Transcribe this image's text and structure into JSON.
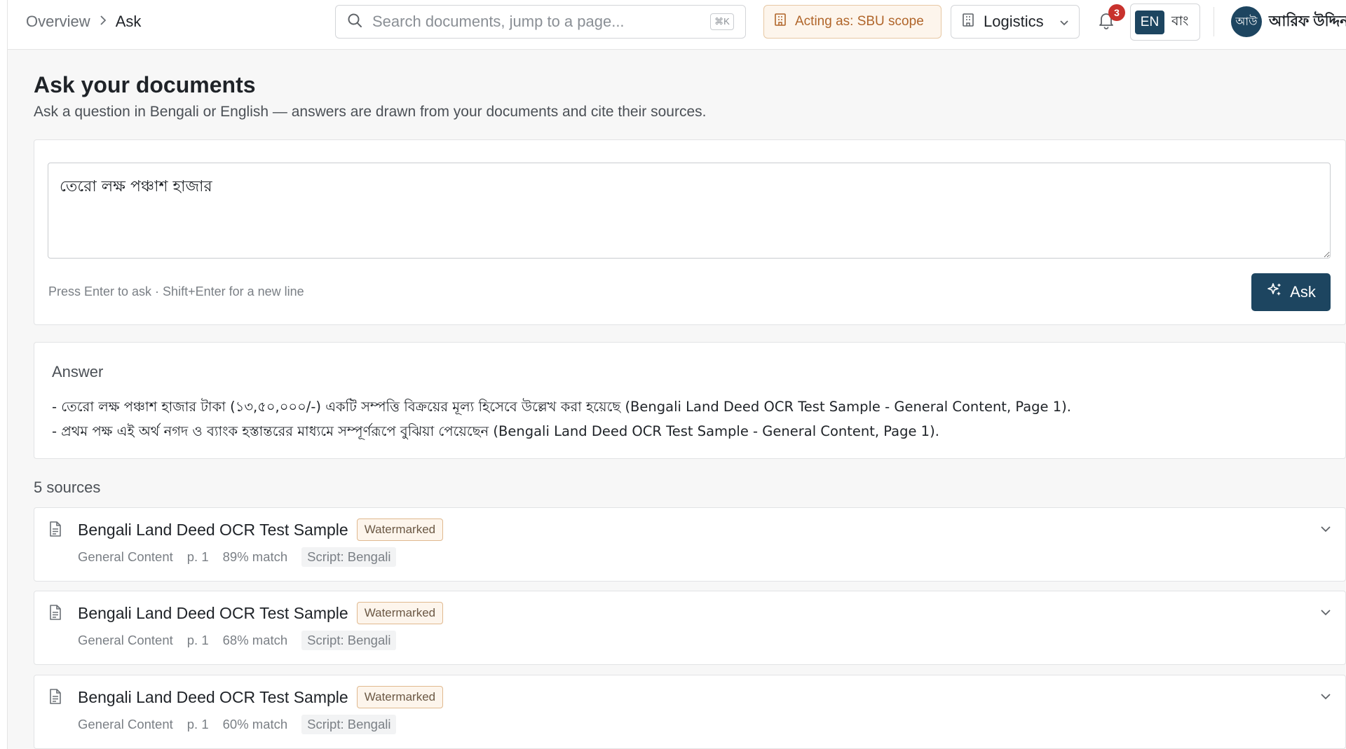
{
  "breadcrumb": {
    "root": "Overview",
    "current": "Ask"
  },
  "search": {
    "placeholder": "Search documents, jump to a page...",
    "shortcut": "⌘K"
  },
  "scope": {
    "label": "Acting as: SBU scope"
  },
  "org": {
    "label": "Logistics"
  },
  "notifications": {
    "count": "3"
  },
  "language": {
    "en": "EN",
    "bn": "বাং"
  },
  "user": {
    "initials": "আউ",
    "name": "আরিফ উদ্দিন"
  },
  "page": {
    "title": "Ask your documents",
    "subtitle": "Ask a question in Bengali or English — answers are drawn from your documents and cite their sources."
  },
  "ask": {
    "question": "তেরো লক্ষ পঞ্চাশ হাজার",
    "hint": "Press Enter to ask · Shift+Enter for a new line",
    "button_label": "Ask"
  },
  "answer": {
    "label": "Answer",
    "lines": [
      "- তেরো লক্ষ পঞ্চাশ হাজার টাকা (১৩,৫০,০০০/-) একটি সম্পত্তি বিক্রয়ের মূল্য হিসেবে উল্লেখ করা হয়েছে (Bengali Land Deed OCR Test Sample - General Content, Page 1).",
      "- প্রথম পক্ষ এই অর্থ নগদ ও ব্যাংক হস্তান্তরের মাধ্যমে সম্পূর্ণরূপে বুঝিয়া পেয়েছেন (Bengali Land Deed OCR Test Sample - General Content, Page 1)."
    ]
  },
  "sources": {
    "count_label": "5 sources",
    "items": [
      {
        "title": "Bengali Land Deed OCR Test Sample",
        "badge": "Watermarked",
        "category": "General Content",
        "page": "p. 1",
        "match": "89% match",
        "script": "Script: Bengali"
      },
      {
        "title": "Bengali Land Deed OCR Test Sample",
        "badge": "Watermarked",
        "category": "General Content",
        "page": "p. 1",
        "match": "68% match",
        "script": "Script: Bengali"
      },
      {
        "title": "Bengali Land Deed OCR Test Sample",
        "badge": "Watermarked",
        "category": "General Content",
        "page": "p. 1",
        "match": "60% match",
        "script": "Script: Bengali"
      }
    ]
  },
  "colors": {
    "primary": "#1d4560",
    "scope_accent": "#b0652a",
    "badge_red": "#c8322d"
  },
  "icons": {
    "search": "search-icon",
    "scope": "building-icon",
    "org": "building-icon",
    "bell": "bell-icon",
    "ask": "sparkle-icon",
    "doc": "document-icon",
    "chevron": "chevron-down-icon"
  }
}
